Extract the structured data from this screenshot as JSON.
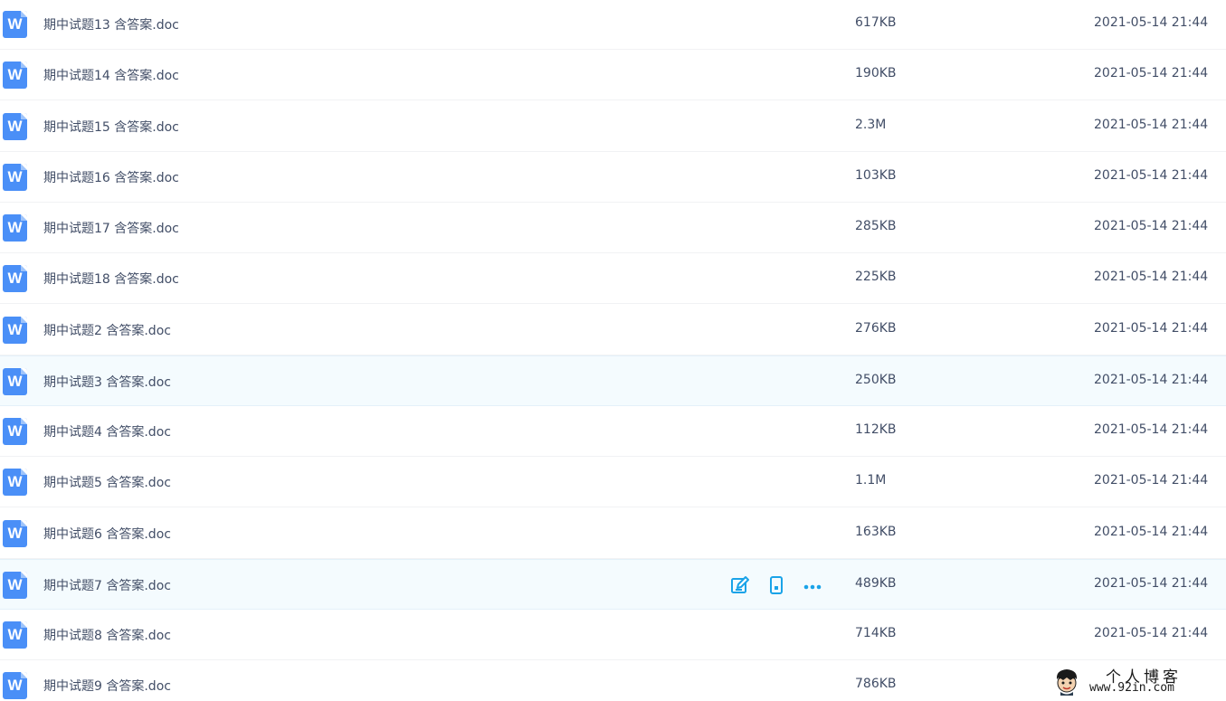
{
  "files": [
    {
      "name": "期中试题13 含答案.doc",
      "size": "617KB",
      "date": "2021-05-14 21:44"
    },
    {
      "name": "期中试题14 含答案.doc",
      "size": "190KB",
      "date": "2021-05-14 21:44"
    },
    {
      "name": "期中试题15 含答案.doc",
      "size": "2.3M",
      "date": "2021-05-14 21:44"
    },
    {
      "name": "期中试题16 含答案.doc",
      "size": "103KB",
      "date": "2021-05-14 21:44"
    },
    {
      "name": "期中试题17 含答案.doc",
      "size": "285KB",
      "date": "2021-05-14 21:44"
    },
    {
      "name": "期中试题18 含答案.doc",
      "size": "225KB",
      "date": "2021-05-14 21:44"
    },
    {
      "name": "期中试题2 含答案.doc",
      "size": "276KB",
      "date": "2021-05-14 21:44"
    },
    {
      "name": "期中试题3 含答案.doc",
      "size": "250KB",
      "date": "2021-05-14 21:44"
    },
    {
      "name": "期中试题4 含答案.doc",
      "size": "112KB",
      "date": "2021-05-14 21:44"
    },
    {
      "name": "期中试题5 含答案.doc",
      "size": "1.1M",
      "date": "2021-05-14 21:44"
    },
    {
      "name": "期中试题6 含答案.doc",
      "size": "163KB",
      "date": "2021-05-14 21:44"
    },
    {
      "name": "期中试题7 含答案.doc",
      "size": "489KB",
      "date": "2021-05-14 21:44"
    },
    {
      "name": "期中试题8 含答案.doc",
      "size": "714KB",
      "date": "2021-05-14 21:44"
    },
    {
      "name": "期中试题9 含答案.doc",
      "size": "786KB",
      "date": ""
    }
  ],
  "file_icon": {
    "name": "word-doc-icon",
    "letter": "W",
    "color": "#4a8ff7"
  },
  "row_actions": [
    {
      "name": "edit-icon",
      "color": "#1aa3e8"
    },
    {
      "name": "mobile-phone-icon",
      "color": "#1aa3e8"
    },
    {
      "name": "more-options-icon",
      "color": "#1aa3e8"
    }
  ],
  "colors": {
    "text": "#424e67",
    "highlight_row": "#f4fbfe",
    "accent": "#1aa3e8"
  },
  "watermark": {
    "title": "个人博客",
    "url": "www.92in.com"
  }
}
